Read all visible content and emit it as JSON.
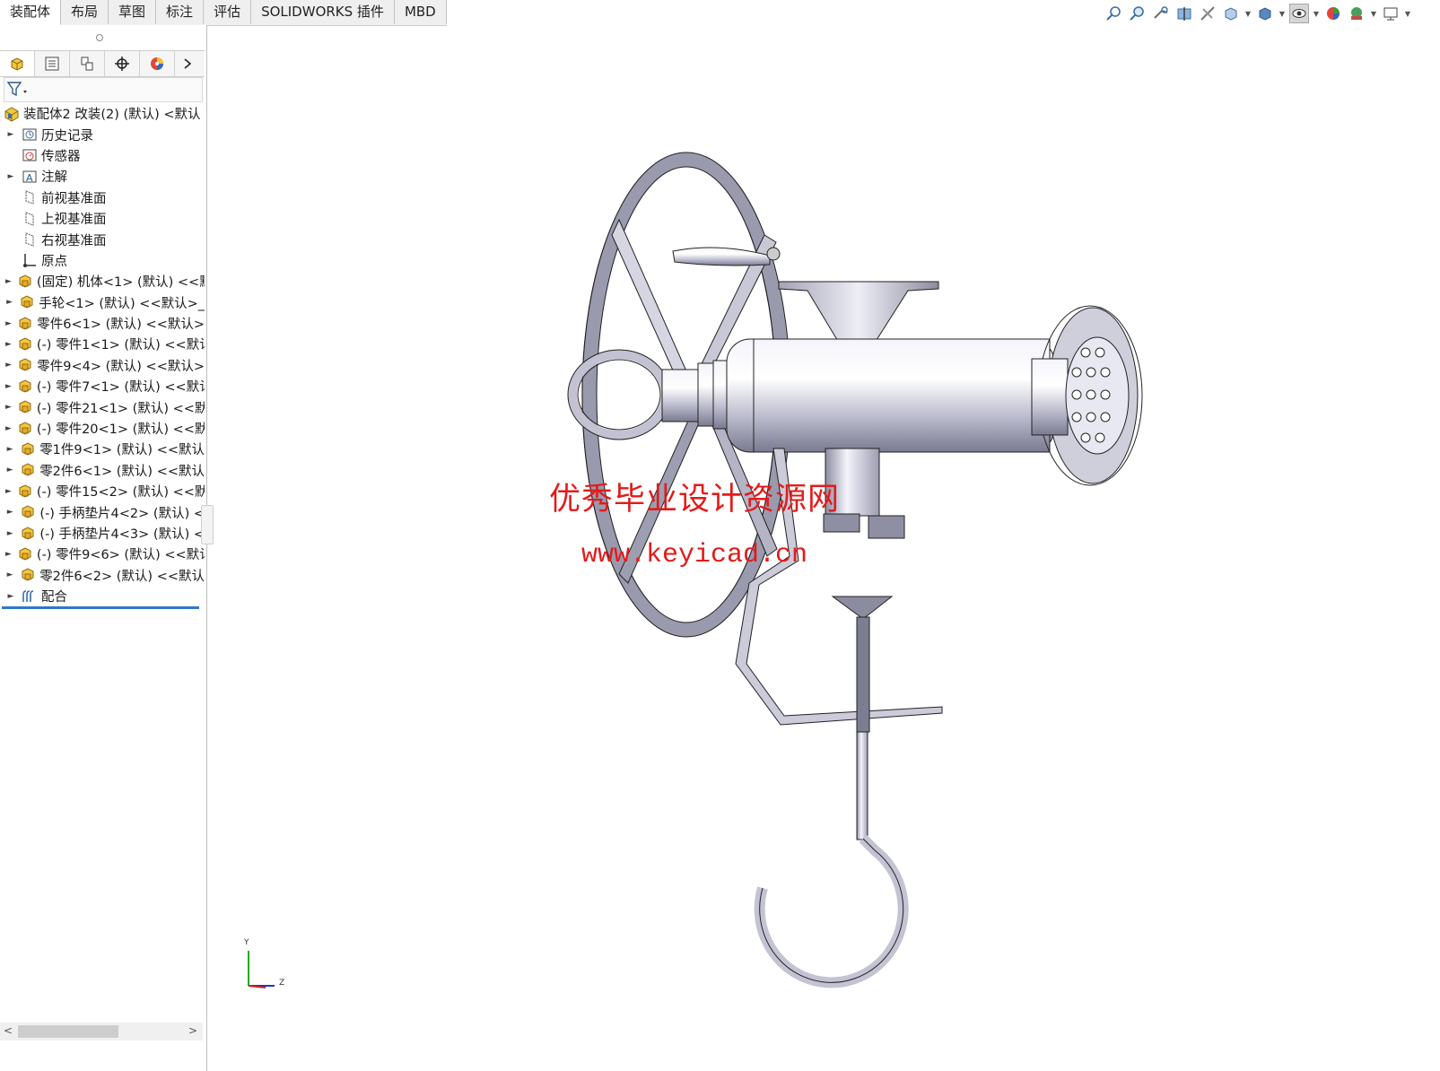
{
  "tabs": [
    {
      "label": "装配体",
      "active": true
    },
    {
      "label": "布局"
    },
    {
      "label": "草图"
    },
    {
      "label": "标注"
    },
    {
      "label": "评估"
    },
    {
      "label": "SOLIDWORKS 插件"
    },
    {
      "label": "MBD"
    }
  ],
  "view_tools": [
    "zoom-to-fit-icon",
    "zoom-area-icon",
    "previous-view-icon",
    "section-view-icon",
    "dynamic-annotation-icon",
    "view-orientation-icon",
    "display-style-icon",
    "hide-show-items-icon",
    "edit-appearance-icon",
    "apply-scene-icon",
    "view-settings-icon"
  ],
  "feature_tree": {
    "root": "装配体2  改装(2) (默认) <默认",
    "items": [
      {
        "label": "历史记录",
        "icon": "history-icon",
        "expand": true
      },
      {
        "label": "传感器",
        "icon": "sensor-icon",
        "expand": false
      },
      {
        "label": "注解",
        "icon": "annotation-icon",
        "expand": true
      },
      {
        "label": "前视基准面",
        "icon": "plane-icon",
        "expand": false
      },
      {
        "label": "上视基准面",
        "icon": "plane-icon",
        "expand": false
      },
      {
        "label": "右视基准面",
        "icon": "plane-icon",
        "expand": false
      },
      {
        "label": "原点",
        "icon": "origin-icon",
        "expand": false
      },
      {
        "label": "(固定) 机体<1> (默认) <<默",
        "icon": "part-icon",
        "expand": true
      },
      {
        "label": "手轮<1> (默认) <<默认>_",
        "icon": "part-icon",
        "expand": true
      },
      {
        "label": "零件6<1> (默认) <<默认>",
        "icon": "part-icon",
        "expand": true
      },
      {
        "label": "(-) 零件1<1> (默认) <<默认",
        "icon": "part-icon",
        "expand": true
      },
      {
        "label": "零件9<4> (默认) <<默认>",
        "icon": "part-icon",
        "expand": true
      },
      {
        "label": "(-) 零件7<1> (默认) <<默认",
        "icon": "part-icon",
        "expand": true
      },
      {
        "label": "(-) 零件21<1> (默认) <<默",
        "icon": "part-icon",
        "expand": true
      },
      {
        "label": "(-) 零件20<1> (默认) <<默",
        "icon": "part-icon",
        "expand": true
      },
      {
        "label": "零1件9<1> (默认) <<默认",
        "icon": "part-icon",
        "expand": true
      },
      {
        "label": "零2件6<1> (默认) <<默认",
        "icon": "part-icon",
        "expand": true
      },
      {
        "label": "(-) 零件15<2> (默认) <<默",
        "icon": "part-icon",
        "expand": true
      },
      {
        "label": "(-) 手柄垫片4<2> (默认) <",
        "icon": "part-icon",
        "expand": true
      },
      {
        "label": "(-) 手柄垫片4<3> (默认) <",
        "icon": "part-icon",
        "expand": true
      },
      {
        "label": "(-) 零件9<6> (默认) <<默认",
        "icon": "part-icon",
        "expand": true
      },
      {
        "label": "零2件6<2> (默认) <<默认",
        "icon": "part-icon",
        "expand": true
      },
      {
        "label": "配合",
        "icon": "mates-icon",
        "expand": true
      }
    ]
  },
  "watermark": {
    "line1": "优秀毕业设计资源网",
    "line2": "www.keyicad.cn",
    "color": "#e21b1b"
  },
  "triad": {
    "y": "Y",
    "z": "Z"
  },
  "colors": {
    "accent": "#2f78c8",
    "model_light": "#e9e9f3",
    "model_dark": "#6c6c80"
  }
}
